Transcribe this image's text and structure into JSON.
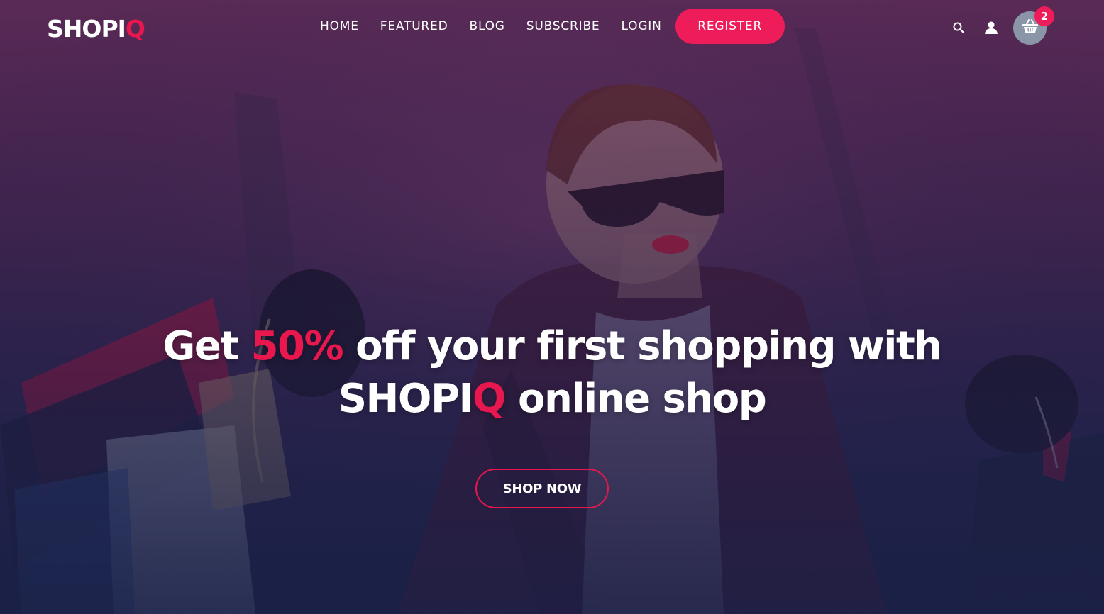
{
  "brand": {
    "logo_main": "SHOPI",
    "logo_accent": "Q"
  },
  "nav": {
    "items": [
      "HOME",
      "FEATURED",
      "BLOG",
      "SUBSCRIBE",
      "LOGIN"
    ],
    "register_label": "REGISTER"
  },
  "header_icons": {
    "search": "search-icon",
    "user": "user-icon",
    "cart": "basket-icon",
    "cart_count": "2"
  },
  "hero": {
    "line1_before": "Get ",
    "line1_highlight": "50%",
    "line1_after": " off your first shopping with",
    "line2_brand_main": "SHOPI",
    "line2_brand_accent": "Q",
    "line2_after": " online shop",
    "cta_label": "SHOP NOW"
  },
  "colors": {
    "accent": "#ef1c5a",
    "overlay_top": "#5a2a55",
    "overlay_bottom": "#1c2248",
    "cart_bg": "#8a96a8"
  }
}
